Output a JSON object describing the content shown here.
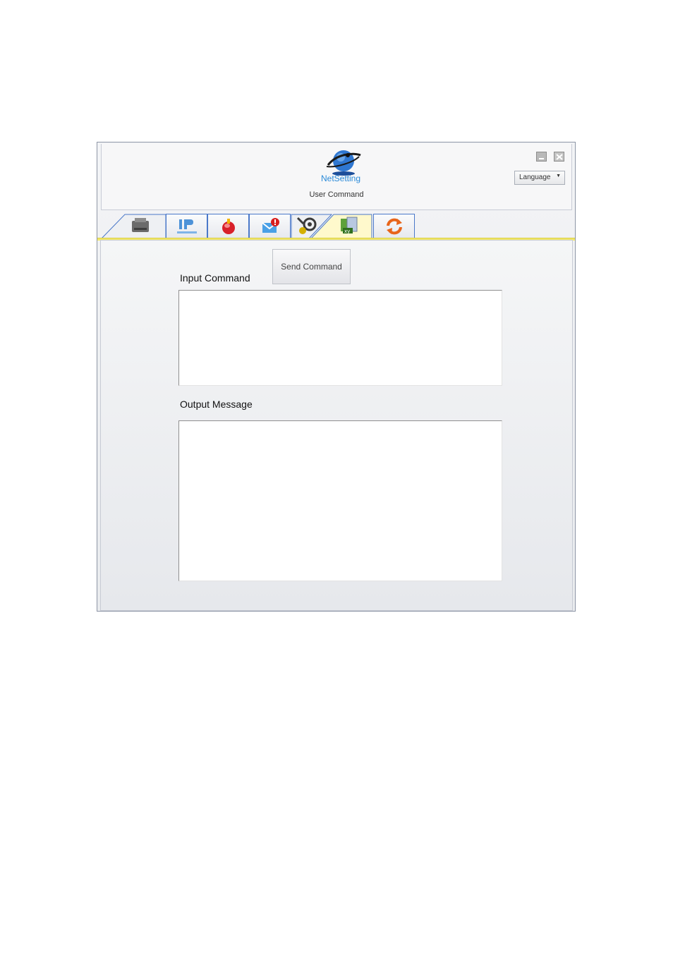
{
  "app": {
    "logo_text": "NetSetting",
    "page_title": "User Command",
    "language_select": {
      "selected": "Language"
    }
  },
  "tabs": [
    {
      "icon": "printer-icon",
      "active": false
    },
    {
      "icon": "ip-network-icon",
      "active": false
    },
    {
      "icon": "alert-icon",
      "active": false
    },
    {
      "icon": "mail-alert-icon",
      "active": false
    },
    {
      "icon": "gear-settings-icon",
      "active": false
    },
    {
      "icon": "user-command-icon",
      "active": true
    },
    {
      "icon": "refresh-icon",
      "active": false
    }
  ],
  "main": {
    "send_button": "Send Command",
    "input_label": "Input Command",
    "input_value": "",
    "output_label": "Output Message",
    "output_value": ""
  },
  "colors": {
    "tab_border": "#4a78c9",
    "active_tab": "#fff6b8",
    "tab_underline": "#f2e86a"
  }
}
